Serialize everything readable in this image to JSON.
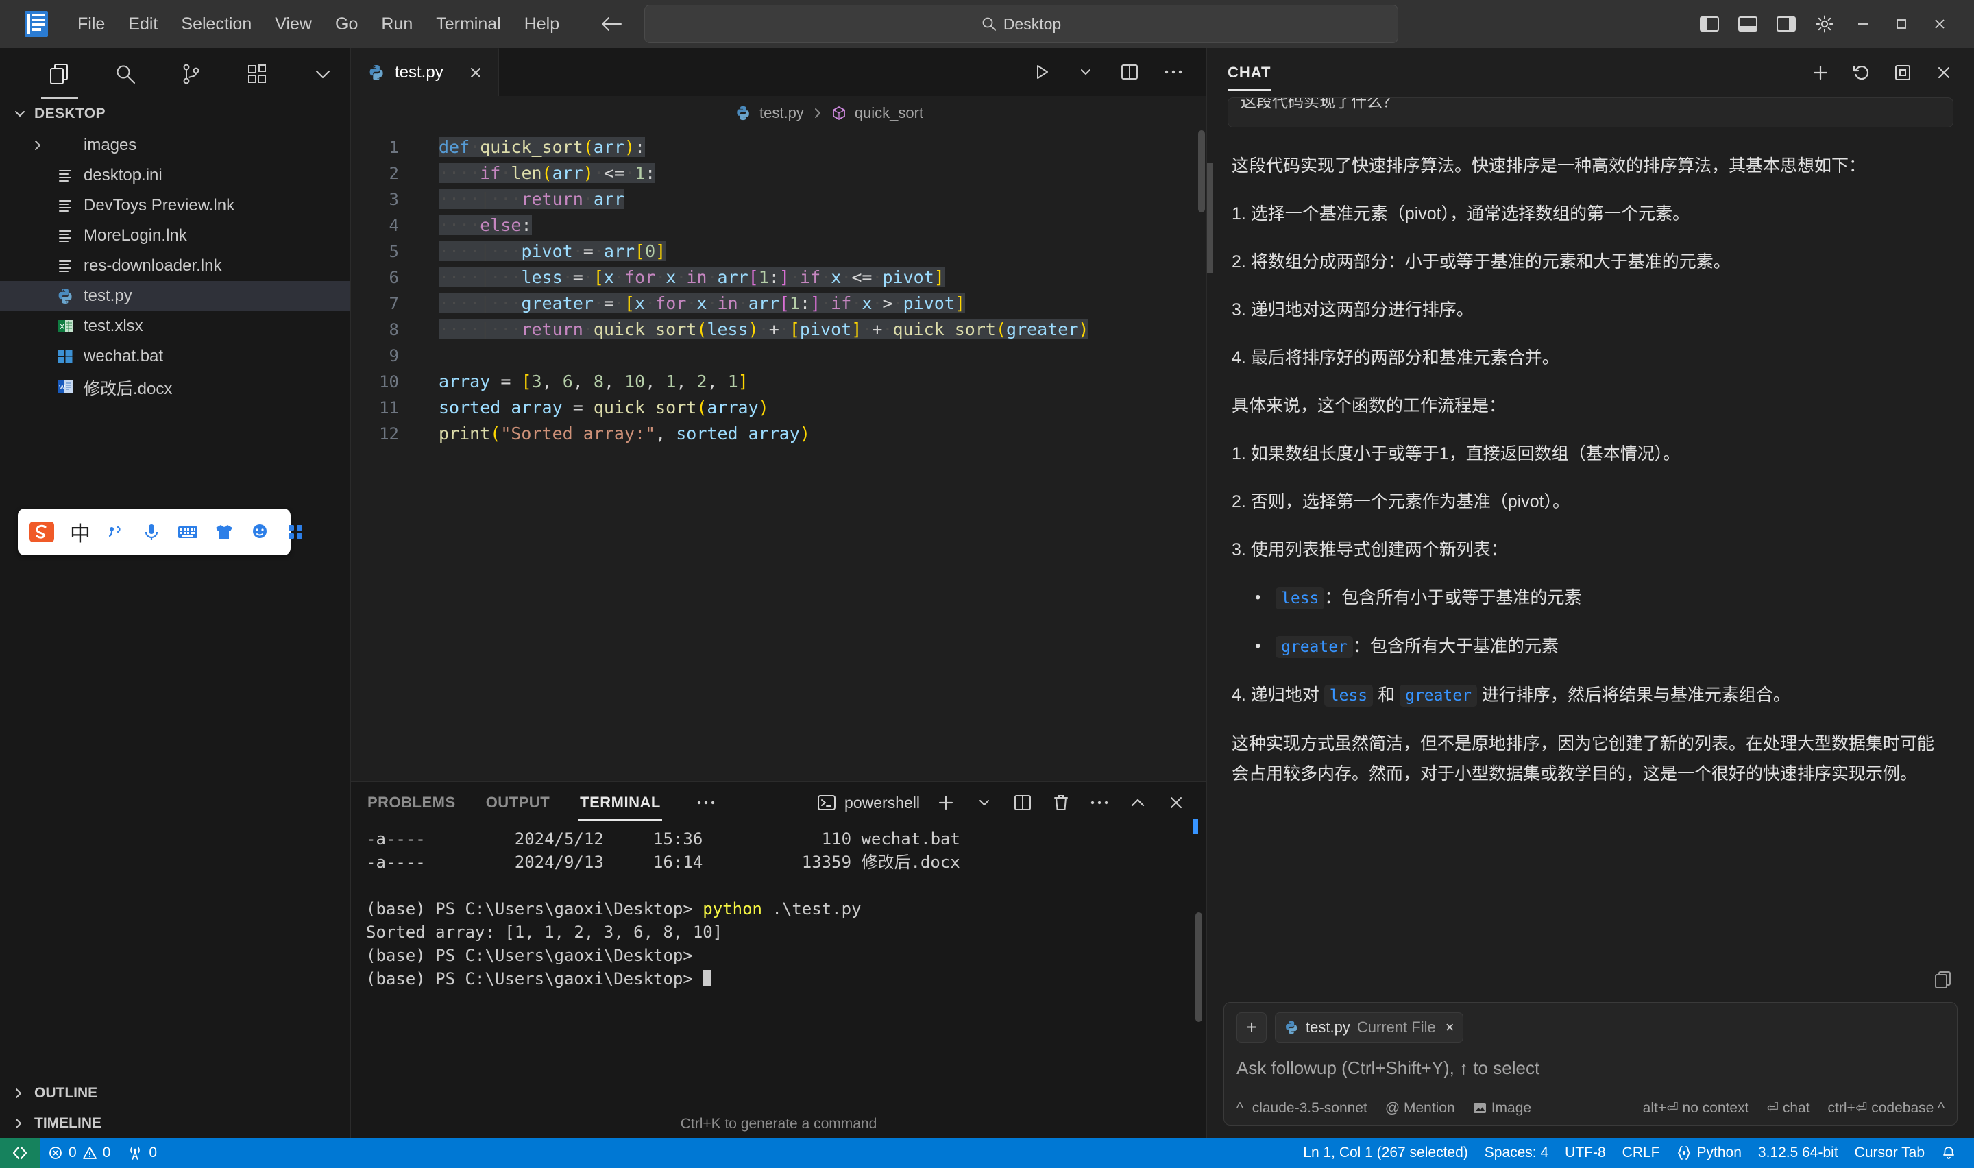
{
  "titlebar": {
    "logo_name": "vscode-logo",
    "menus": [
      "File",
      "Edit",
      "Selection",
      "View",
      "Go",
      "Run",
      "Terminal",
      "Help"
    ],
    "back_icon": "arrow-left-icon",
    "forward_icon": "arrow-right-icon",
    "search_value": "Desktop",
    "search_icon": "search-icon",
    "layout_icons": [
      "toggle-primary-sidebar-icon",
      "toggle-panel-icon",
      "toggle-secondary-sidebar-icon",
      "customize-layout-icon"
    ],
    "window_buttons": [
      "minimize-button",
      "maximize-button",
      "close-button"
    ]
  },
  "activitybar": {
    "icons": [
      "explorer-icon",
      "search-icon",
      "source-control-icon",
      "extensions-icon",
      "chevron-down-icon"
    ]
  },
  "explorer": {
    "title": "DESKTOP",
    "chevron": "chevron-down-icon",
    "items": [
      {
        "label": "images",
        "icon": "folder-icon",
        "twisty": "chevron-right-icon",
        "selected": false
      },
      {
        "label": "desktop.ini",
        "icon": "config-file-icon",
        "twisty": "",
        "selected": false
      },
      {
        "label": "DevToys Preview.lnk",
        "icon": "config-file-icon",
        "twisty": "",
        "selected": false
      },
      {
        "label": "MoreLogin.lnk",
        "icon": "config-file-icon",
        "twisty": "",
        "selected": false
      },
      {
        "label": "res-downloader.lnk",
        "icon": "config-file-icon",
        "twisty": "",
        "selected": false
      },
      {
        "label": "test.py",
        "icon": "python-file-icon",
        "twisty": "",
        "selected": true
      },
      {
        "label": "test.xlsx",
        "icon": "excel-file-icon",
        "twisty": "",
        "selected": false
      },
      {
        "label": "wechat.bat",
        "icon": "windows-bat-icon",
        "twisty": "",
        "selected": false
      },
      {
        "label": "修改后.docx",
        "icon": "word-file-icon",
        "twisty": "",
        "selected": false
      }
    ],
    "sections": [
      {
        "label": "OUTLINE",
        "chevron": "chevron-right-icon"
      },
      {
        "label": "TIMELINE",
        "chevron": "chevron-right-icon"
      }
    ]
  },
  "ime_toolbar": {
    "logo": "sogou-logo-icon",
    "mode_label": "中",
    "icons": [
      "voice-punctuation-icon",
      "microphone-icon",
      "keyboard-icon",
      "skin-icon",
      "emoji-icon",
      "apps-icon"
    ]
  },
  "editor": {
    "tab": {
      "label": "test.py",
      "icon": "python-file-icon",
      "close_icon": "close-icon"
    },
    "actions": [
      "run-icon",
      "run-dropdown-icon",
      "split-editor-icon",
      "more-actions-icon"
    ],
    "breadcrumb": [
      "test.py",
      "quick_sort"
    ],
    "breadcrumb_icons": [
      "python-file-icon",
      "symbol-method-icon"
    ],
    "lines": [
      {
        "num": "1",
        "text": "def quick_sort(arr):"
      },
      {
        "num": "2",
        "text": "    if len(arr) <= 1:"
      },
      {
        "num": "3",
        "text": "        return arr"
      },
      {
        "num": "4",
        "text": "    else:"
      },
      {
        "num": "5",
        "text": "        pivot = arr[0]"
      },
      {
        "num": "6",
        "text": "        less = [x for x in arr[1:] if x <= pivot]"
      },
      {
        "num": "7",
        "text": "        greater = [x for x in arr[1:] if x > pivot]"
      },
      {
        "num": "8",
        "text": "        return quick_sort(less) + [pivot] + quick_sort(greater)"
      },
      {
        "num": "9",
        "text": ""
      },
      {
        "num": "10",
        "text": "array = [3, 6, 8, 10, 1, 2, 1]"
      },
      {
        "num": "11",
        "text": "sorted_array = quick_sort(array)"
      },
      {
        "num": "12",
        "text": "print(\"Sorted array:\", sorted_array)"
      }
    ]
  },
  "panel": {
    "tabs": [
      "PROBLEMS",
      "OUTPUT",
      "TERMINAL"
    ],
    "active_tab": "TERMINAL",
    "more_icon": "more-actions-icon",
    "shell": {
      "name": "powershell",
      "icon": "terminal-powershell-icon"
    },
    "actions": [
      "new-terminal-icon",
      "new-terminal-dropdown-icon",
      "split-terminal-icon",
      "kill-terminal-icon",
      "more-actions-icon",
      "chevron-up-icon",
      "close-icon"
    ],
    "terminal_lines": [
      "-a----         2024/5/12     15:36            110 wechat.bat",
      "-a----         2024/9/13     16:14          13359 修改后.docx",
      "",
      "(base) PS C:\\Users\\gaoxi\\Desktop> python .\\test.py",
      "Sorted array: [1, 1, 2, 3, 6, 8, 10]",
      "(base) PS C:\\Users\\gaoxi\\Desktop>",
      "(base) PS C:\\Users\\gaoxi\\Desktop> "
    ],
    "command_highlight": "python",
    "hint": "Ctrl+K to generate a command"
  },
  "chat": {
    "title": "CHAT",
    "actions": [
      "new-chat-icon",
      "history-icon",
      "open-in-editor-icon",
      "close-icon"
    ],
    "previous_message_snippet": "这段代码实现了什么？",
    "copy_icon": "copy-icon",
    "message": {
      "intro": "这段代码实现了快速排序算法。快速排序是一种高效的排序算法，其基本思想如下：",
      "steps": [
        "1. 选择一个基准元素（pivot），通常选择数组的第一个元素。",
        "2. 将数组分成两部分：小于或等于基准的元素和大于基准的元素。",
        "3. 递归地对这两部分进行排序。",
        "4. 最后将排序好的两部分和基准元素合并。"
      ],
      "detail_heading": "具体来说，这个函数的工作流程是：",
      "detail_1": "1. 如果数组长度小于或等于1，直接返回数组（基本情况）。",
      "detail_2": "2. 否则，选择第一个元素作为基准（pivot）。",
      "detail_3": "3. 使用列表推导式创建两个新列表：",
      "bullets": [
        {
          "code": "less",
          "text": "：包含所有小于或等于基准的元素"
        },
        {
          "code": "greater",
          "text": "：包含所有大于基准的元素"
        }
      ],
      "detail_4_a": "4. 递归地对 ",
      "detail_4_code1": "less",
      "detail_4_b": " 和 ",
      "detail_4_code2": "greater",
      "detail_4_c": " 进行排序，然后将结果与基准元素组合。",
      "conclusion": "这种实现方式虽然简洁，但不是原地排序，因为它创建了新的列表。在处理大型数据集时可能会占用较多内存。然而，对于小型数据集或教学目的，这是一个很好的快速排序实现示例。"
    },
    "input": {
      "plus_label": "+",
      "chip_file": "test.py",
      "chip_context": "Current File",
      "chip_close": "×",
      "placeholder": "Ask followup (Ctrl+Shift+Y), ↑ to select",
      "model": "claude-3.5-sonnet",
      "mention": "@ Mention",
      "image": "Image",
      "hint_no_context": "alt+⏎ no context",
      "hint_chat": "⏎ chat",
      "hint_codebase": "ctrl+⏎ codebase ^"
    }
  },
  "statusbar": {
    "remote_icon": "remote-explorer-icon",
    "errors_icon": "error-icon",
    "errors": "0",
    "warnings_icon": "warning-icon",
    "warnings": "0",
    "ports_icon": "radio-tower-icon",
    "ports": "0",
    "cursor_position": "Ln 1, Col 1 (267 selected)",
    "indentation": "Spaces: 4",
    "encoding": "UTF-8",
    "eol": "CRLF",
    "language_icon": "python-brackets-icon",
    "language": "Python",
    "interpreter": "3.12.5 64-bit",
    "cursor_tab": "Cursor Tab",
    "bell_icon": "bell-icon"
  },
  "colors": {
    "accent": "#0078d4",
    "remote": "#16825d",
    "selection": "#3a3d41",
    "keyword": "#569cd6",
    "control": "#c586c0",
    "function": "#dcdcaa",
    "variable": "#9cdcfe",
    "number": "#b5cea8",
    "string": "#ce9178",
    "bracket1": "#ffd700",
    "bracket2": "#da70d6",
    "inline_code": "#3794ff"
  }
}
